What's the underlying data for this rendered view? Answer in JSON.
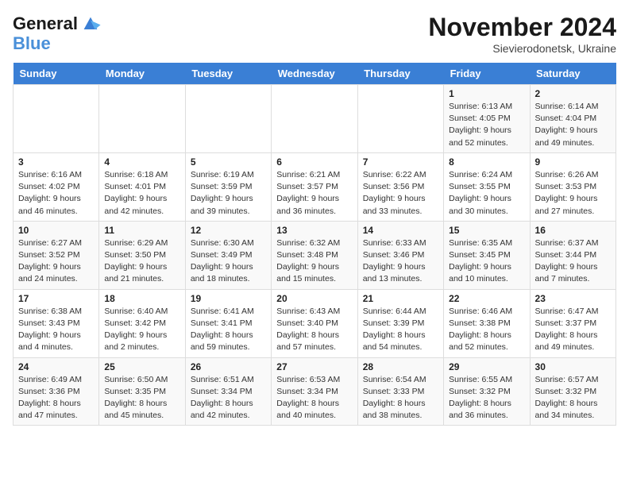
{
  "logo": {
    "line1": "General",
    "line2": "Blue"
  },
  "title": "November 2024",
  "subtitle": "Sievierodonetsk, Ukraine",
  "days_of_week": [
    "Sunday",
    "Monday",
    "Tuesday",
    "Wednesday",
    "Thursday",
    "Friday",
    "Saturday"
  ],
  "weeks": [
    [
      {
        "day": "",
        "info": ""
      },
      {
        "day": "",
        "info": ""
      },
      {
        "day": "",
        "info": ""
      },
      {
        "day": "",
        "info": ""
      },
      {
        "day": "",
        "info": ""
      },
      {
        "day": "1",
        "info": "Sunrise: 6:13 AM\nSunset: 4:05 PM\nDaylight: 9 hours\nand 52 minutes."
      },
      {
        "day": "2",
        "info": "Sunrise: 6:14 AM\nSunset: 4:04 PM\nDaylight: 9 hours\nand 49 minutes."
      }
    ],
    [
      {
        "day": "3",
        "info": "Sunrise: 6:16 AM\nSunset: 4:02 PM\nDaylight: 9 hours\nand 46 minutes."
      },
      {
        "day": "4",
        "info": "Sunrise: 6:18 AM\nSunset: 4:01 PM\nDaylight: 9 hours\nand 42 minutes."
      },
      {
        "day": "5",
        "info": "Sunrise: 6:19 AM\nSunset: 3:59 PM\nDaylight: 9 hours\nand 39 minutes."
      },
      {
        "day": "6",
        "info": "Sunrise: 6:21 AM\nSunset: 3:57 PM\nDaylight: 9 hours\nand 36 minutes."
      },
      {
        "day": "7",
        "info": "Sunrise: 6:22 AM\nSunset: 3:56 PM\nDaylight: 9 hours\nand 33 minutes."
      },
      {
        "day": "8",
        "info": "Sunrise: 6:24 AM\nSunset: 3:55 PM\nDaylight: 9 hours\nand 30 minutes."
      },
      {
        "day": "9",
        "info": "Sunrise: 6:26 AM\nSunset: 3:53 PM\nDaylight: 9 hours\nand 27 minutes."
      }
    ],
    [
      {
        "day": "10",
        "info": "Sunrise: 6:27 AM\nSunset: 3:52 PM\nDaylight: 9 hours\nand 24 minutes."
      },
      {
        "day": "11",
        "info": "Sunrise: 6:29 AM\nSunset: 3:50 PM\nDaylight: 9 hours\nand 21 minutes."
      },
      {
        "day": "12",
        "info": "Sunrise: 6:30 AM\nSunset: 3:49 PM\nDaylight: 9 hours\nand 18 minutes."
      },
      {
        "day": "13",
        "info": "Sunrise: 6:32 AM\nSunset: 3:48 PM\nDaylight: 9 hours\nand 15 minutes."
      },
      {
        "day": "14",
        "info": "Sunrise: 6:33 AM\nSunset: 3:46 PM\nDaylight: 9 hours\nand 13 minutes."
      },
      {
        "day": "15",
        "info": "Sunrise: 6:35 AM\nSunset: 3:45 PM\nDaylight: 9 hours\nand 10 minutes."
      },
      {
        "day": "16",
        "info": "Sunrise: 6:37 AM\nSunset: 3:44 PM\nDaylight: 9 hours\nand 7 minutes."
      }
    ],
    [
      {
        "day": "17",
        "info": "Sunrise: 6:38 AM\nSunset: 3:43 PM\nDaylight: 9 hours\nand 4 minutes."
      },
      {
        "day": "18",
        "info": "Sunrise: 6:40 AM\nSunset: 3:42 PM\nDaylight: 9 hours\nand 2 minutes."
      },
      {
        "day": "19",
        "info": "Sunrise: 6:41 AM\nSunset: 3:41 PM\nDaylight: 8 hours\nand 59 minutes."
      },
      {
        "day": "20",
        "info": "Sunrise: 6:43 AM\nSunset: 3:40 PM\nDaylight: 8 hours\nand 57 minutes."
      },
      {
        "day": "21",
        "info": "Sunrise: 6:44 AM\nSunset: 3:39 PM\nDaylight: 8 hours\nand 54 minutes."
      },
      {
        "day": "22",
        "info": "Sunrise: 6:46 AM\nSunset: 3:38 PM\nDaylight: 8 hours\nand 52 minutes."
      },
      {
        "day": "23",
        "info": "Sunrise: 6:47 AM\nSunset: 3:37 PM\nDaylight: 8 hours\nand 49 minutes."
      }
    ],
    [
      {
        "day": "24",
        "info": "Sunrise: 6:49 AM\nSunset: 3:36 PM\nDaylight: 8 hours\nand 47 minutes."
      },
      {
        "day": "25",
        "info": "Sunrise: 6:50 AM\nSunset: 3:35 PM\nDaylight: 8 hours\nand 45 minutes."
      },
      {
        "day": "26",
        "info": "Sunrise: 6:51 AM\nSunset: 3:34 PM\nDaylight: 8 hours\nand 42 minutes."
      },
      {
        "day": "27",
        "info": "Sunrise: 6:53 AM\nSunset: 3:34 PM\nDaylight: 8 hours\nand 40 minutes."
      },
      {
        "day": "28",
        "info": "Sunrise: 6:54 AM\nSunset: 3:33 PM\nDaylight: 8 hours\nand 38 minutes."
      },
      {
        "day": "29",
        "info": "Sunrise: 6:55 AM\nSunset: 3:32 PM\nDaylight: 8 hours\nand 36 minutes."
      },
      {
        "day": "30",
        "info": "Sunrise: 6:57 AM\nSunset: 3:32 PM\nDaylight: 8 hours\nand 34 minutes."
      }
    ]
  ]
}
